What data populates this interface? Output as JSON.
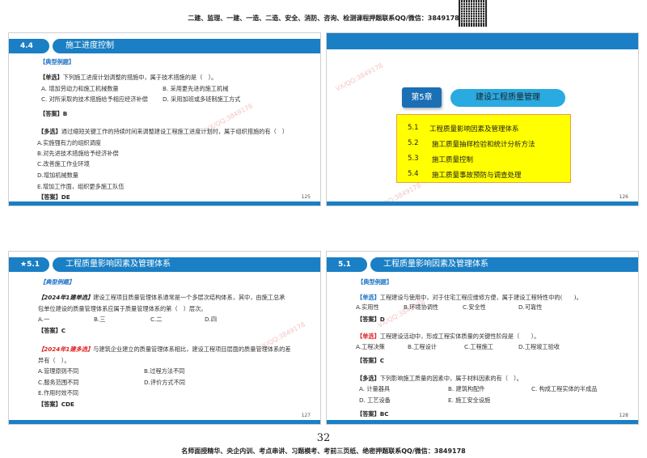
{
  "header_text": "二建、监理、一建、一造、二造、安全、消防、咨询、检测课程押题联系QQ/微信：3849178",
  "footer_text": "名师面授精华、央企内训、考点串讲、习题模考、考前三页纸、绝密押题联系QQ/微信：3849178",
  "page_number": "32",
  "watermark": "VX/QQ:3849178",
  "s1": {
    "badge": "4.4",
    "title": "施工进度控制",
    "section": "【典型例题】",
    "q1_label": "【单选】",
    "q1": "下列施工进度计划调整的措施中，属于技术措施的是（　）。",
    "q1_opts": [
      "A. 增加劳动力和施工机械数量",
      "B. 采用更先进的施工机械",
      "C. 对所采取的技术措施给予相应经济补偿",
      "D. 采用加班或多班制施工方式"
    ],
    "q1_ans": "【答案】B",
    "q2_label": "【多选】",
    "q2": "通过缩短关键工作的持续时间来调整建设工程施工进度计划时，属于组织措施的有（　）",
    "q2_opts": [
      "A.实施强有力的组织调度",
      "B.对先进技术措施给予经济补偿",
      "C.改善施工作业环境",
      "D.增加机械数量",
      "E.增加工作面，组织更多施工队伍"
    ],
    "q2_ans": "【答案】DE",
    "page": "125"
  },
  "s2": {
    "chapter": "第5章",
    "title": "建设工程质量管理",
    "items": [
      {
        "num": "5.1",
        "text": "工程质量影响因素及管理体系"
      },
      {
        "num": "5.2",
        "text": "施工质量抽样检验和统计分析方法"
      },
      {
        "num": "5.3",
        "text": "施工质量控制"
      },
      {
        "num": "5.4",
        "text": "施工质量事故预防与调查处理"
      }
    ],
    "page": "126"
  },
  "s3": {
    "badge": "★5.1",
    "title": "工程质量影响因素及管理体系",
    "section": "【典型例题】",
    "q1_label": "【2024年1建单选】",
    "q1a": "建设工程项目质量管理体系通常是一个多层次结构体系，其中，由施工总承",
    "q1b": "包单位建设的质量管理体系应属于质量管理体系的第（　）层次。",
    "q1_opts": [
      "A.一",
      "B.三",
      "C.二",
      "D.四"
    ],
    "q1_ans": "【答案】C",
    "q2_label": "【2024年1建多选】",
    "q2a": "与建筑企业建立的质量管理体系相比，建设工程项目层面的质量管理体系的差",
    "q2b": "异有（　）。",
    "q2_opts": [
      "A.管理原则不同",
      "B.过程方法不同",
      "C.服务范围不同",
      "D.评价方式不同",
      "E.作用时效不同"
    ],
    "q2_ans": "【答案】CDE",
    "page": "127"
  },
  "s4": {
    "badge": "5.1",
    "title": "工程质量影响因素及管理体系",
    "section": "【典型例题】",
    "q1_label": "【单选】",
    "q1": "工程建设与使用中，对于住宅工程应维修方便，属于建设工程特性中的(　　)。",
    "q1_opts": [
      "A.实用性",
      "B.环境协调性",
      "C.安全性",
      "D.可靠性"
    ],
    "q1_ans": "【答案】D",
    "q2_label": "【单选】",
    "q2": "工程建设活动中，形成工程实体质量的关键性阶段是（　　）。",
    "q2_opts": [
      "A.工程决策",
      "B.工程设计",
      "C.工程施工",
      "D.工程竣工验收"
    ],
    "q2_ans": "【答案】C",
    "q3_label": "【多选】",
    "q3": "下列影响施工质量的因素中，属于材料因素的有（　）。",
    "q3_opts": [
      "A. 计量器具",
      "B. 建筑构配件",
      "C. 构成工程实体的半成品",
      "D. 工艺设备",
      "E. 施工安全设施"
    ],
    "q3_ans": "【答案】BC",
    "page": "128"
  }
}
